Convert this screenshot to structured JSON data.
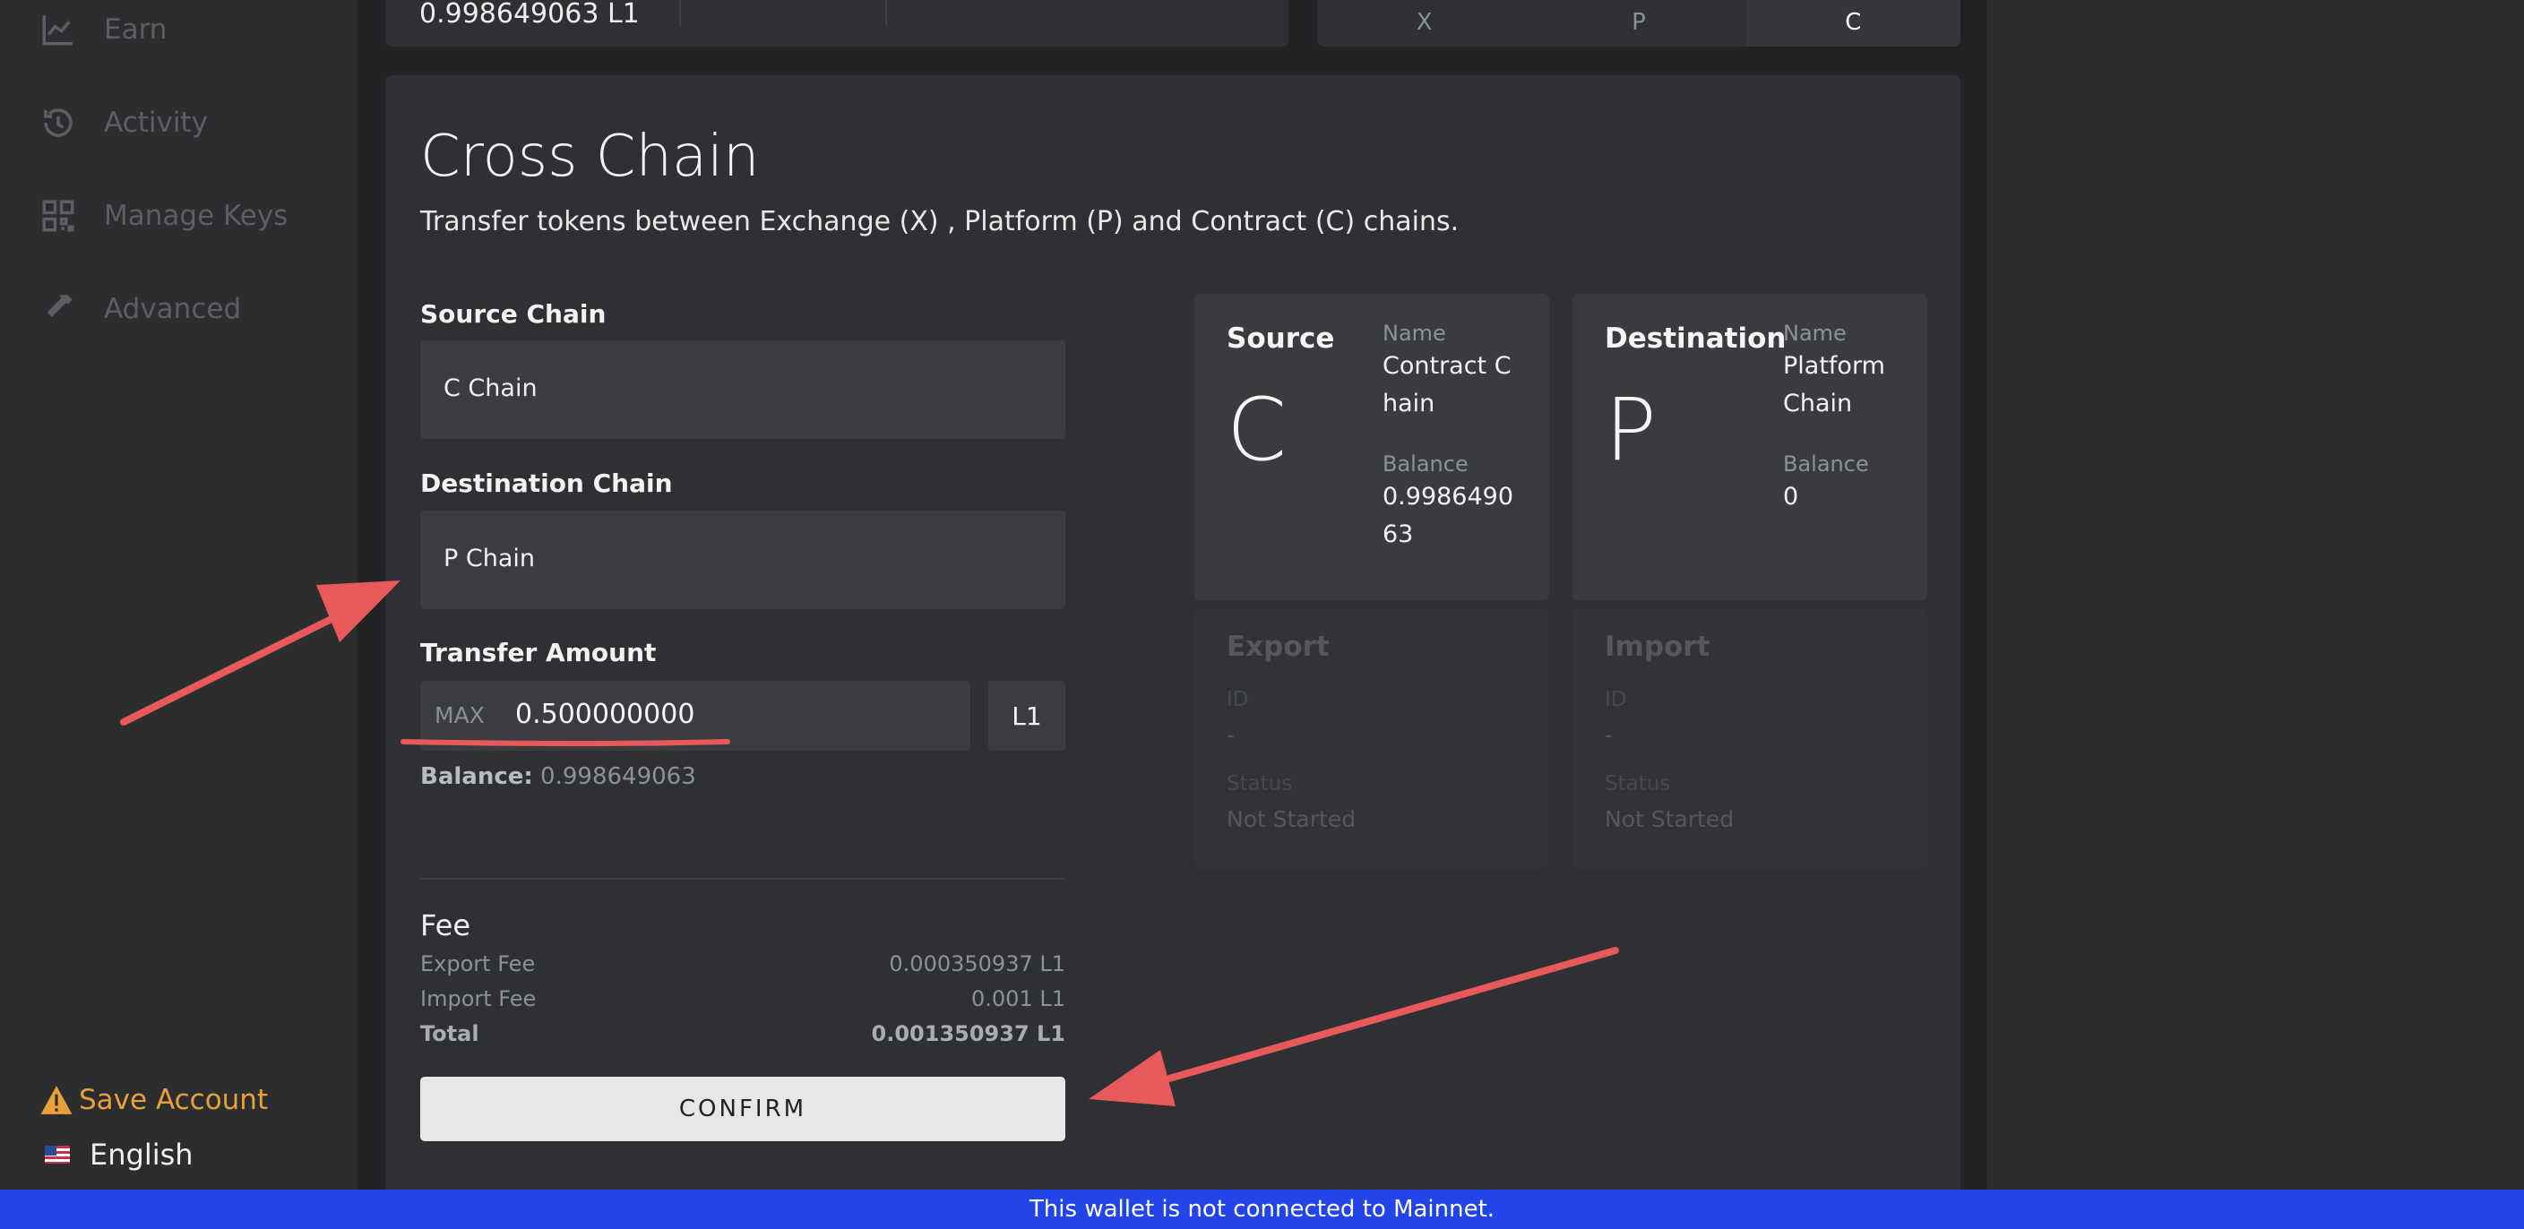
{
  "sidebar": {
    "items": [
      {
        "label": "Earn",
        "icon": "chart-icon"
      },
      {
        "label": "Activity",
        "icon": "history-icon"
      },
      {
        "label": "Manage Keys",
        "icon": "qr-code-icon"
      },
      {
        "label": "Advanced",
        "icon": "hammer-icon"
      }
    ],
    "save_account": "Save Account",
    "language": "English"
  },
  "top": {
    "balance": "0.998649063 L1",
    "tabs": [
      "X",
      "P",
      "C"
    ],
    "active_tab": "C"
  },
  "cross_chain": {
    "title": "Cross Chain",
    "subtitle": "Transfer tokens between Exchange (X) , Platform (P) and Contract (C) chains.",
    "source_label": "Source Chain",
    "source_value": "C Chain",
    "destination_label": "Destination Chain",
    "destination_value": "P Chain",
    "amount_label": "Transfer Amount",
    "max_label": "MAX",
    "amount_value": "0.500000000",
    "unit": "L1",
    "balance_label": "Balance:",
    "balance_value": "0.998649063",
    "fee": {
      "title": "Fee",
      "export_label": "Export Fee",
      "export_value": "0.000350937 L1",
      "import_label": "Import Fee",
      "import_value": "0.001 L1",
      "total_label": "Total",
      "total_value": "0.001350937 L1"
    },
    "confirm_label": "CONFIRM"
  },
  "source_card": {
    "heading": "Source",
    "letter": "C",
    "name_label": "Name",
    "name_line1": "Contract C",
    "name_line2": "hain",
    "balance_label": "Balance",
    "balance_line1": "0.9986490",
    "balance_line2": "63"
  },
  "destination_card": {
    "heading": "Destination",
    "letter": "P",
    "name_label": "Name",
    "name_line1": "Platform",
    "name_line2": "Chain",
    "balance_label": "Balance",
    "balance_value": "0"
  },
  "export_card": {
    "heading": "Export",
    "id_label": "ID",
    "id_value": "-",
    "status_label": "Status",
    "status_value": "Not Started"
  },
  "import_card": {
    "heading": "Import",
    "id_label": "ID",
    "id_value": "-",
    "status_label": "Status",
    "status_value": "Not Started"
  },
  "banner": "This wallet is not connected to Mainnet.",
  "colors": {
    "accent_warning": "#e9a03b",
    "banner": "#2344e6",
    "annotation": "#e85a5a"
  }
}
